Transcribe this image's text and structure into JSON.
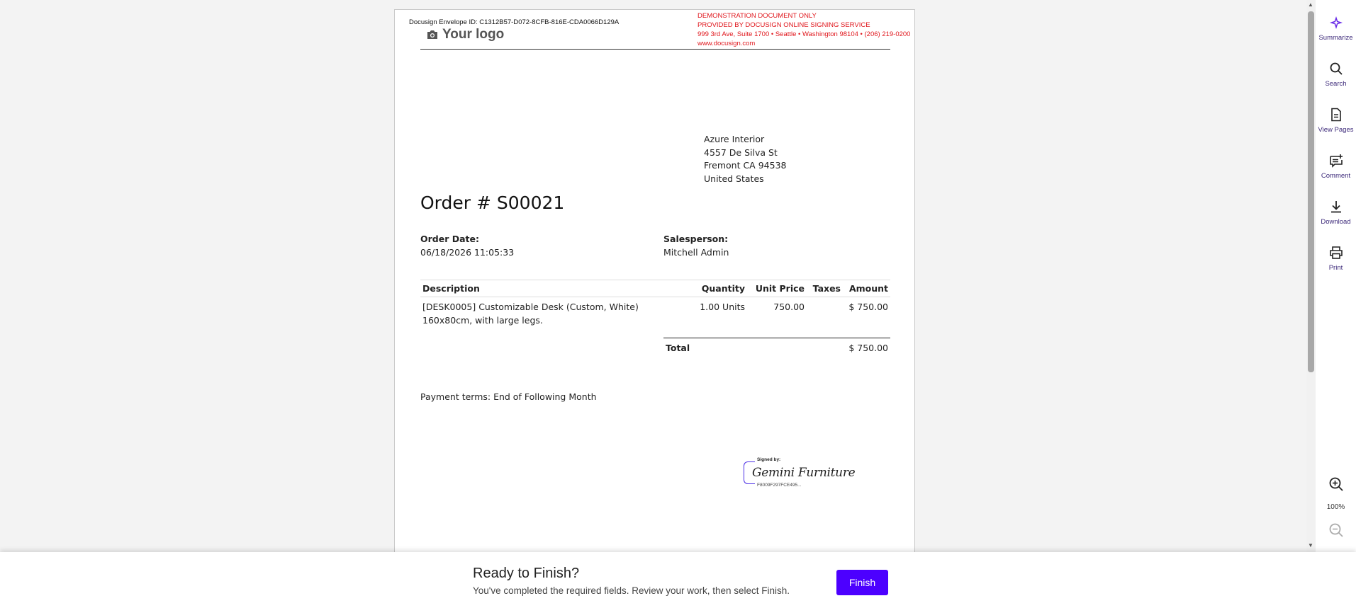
{
  "document": {
    "envelope_id": "Docusign Envelope ID: C1312B57-D072-8CFB-816E-CDA0066D129A",
    "demo_banner": [
      "DEMONSTRATION DOCUMENT ONLY",
      "PROVIDED BY DOCUSIGN ONLINE SIGNING SERVICE",
      "999 3rd Ave, Suite 1700  • Seattle • Washington 98104 • (206) 219-0200",
      "www.docusign.com"
    ],
    "logo_text": "Your logo",
    "address": [
      "Azure Interior",
      "4557 De Silva St",
      "Fremont CA 94538",
      "United States"
    ],
    "order_title": "Order # S00021",
    "order_date_label": "Order Date:",
    "order_date_value": "06/18/2026 11:05:33",
    "salesperson_label": "Salesperson:",
    "salesperson_value": "Mitchell Admin",
    "table": {
      "headers": [
        "Description",
        "Quantity",
        "Unit Price",
        "Taxes",
        "Amount"
      ],
      "rows": [
        {
          "description_line1": "[DESK0005] Customizable Desk (Custom, White)",
          "description_line2": "160x80cm, with large legs.",
          "quantity": "1.00 Units",
          "unit_price": "750.00",
          "taxes": "",
          "amount": "$ 750.00"
        }
      ],
      "total_label": "Total",
      "total_value": "$ 750.00"
    },
    "payment_terms": "Payment terms: End of Following Month",
    "signature": {
      "signed_by": "Signed by:",
      "name": "Gemini Furniture",
      "hash": "F8009F297FCE495..."
    }
  },
  "toolbar": {
    "items": [
      {
        "label": "Summarize",
        "icon": "sparkle-icon"
      },
      {
        "label": "Search",
        "icon": "search-icon"
      },
      {
        "label": "View Pages",
        "icon": "page-icon"
      },
      {
        "label": "Comment",
        "icon": "comment-add-icon"
      },
      {
        "label": "Download",
        "icon": "download-icon"
      },
      {
        "label": "Print",
        "icon": "print-icon"
      }
    ],
    "zoom_level": "100%"
  },
  "finish_bar": {
    "title": "Ready to Finish?",
    "subtitle": "You've completed the required fields. Review your work, then select Finish.",
    "button_label": "Finish"
  },
  "colors": {
    "accent": "#4c00ff",
    "demo_red": "#e0161c",
    "toolbar_label": "#3d2a7a"
  }
}
